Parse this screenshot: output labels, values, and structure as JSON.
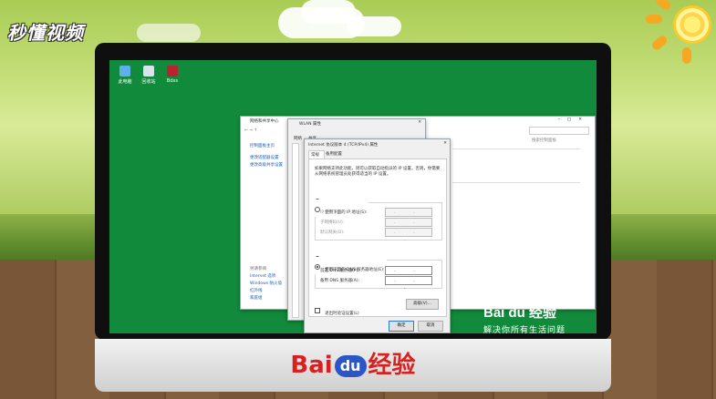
{
  "brand": {
    "name": "秒懂视频"
  },
  "desktop": {
    "icons": [
      {
        "label": "此电脑"
      },
      {
        "label": "回收站"
      },
      {
        "label": "Bdxs"
      }
    ]
  },
  "network_center": {
    "title": "网络和共享中心",
    "sidebar": [
      "控制面板主页",
      "更改适配器设置",
      "更改高级共享设置"
    ],
    "see_also": "另请参阅",
    "see_also_links": [
      "Internet 选项",
      "Windows 防火墙",
      "红外线",
      "家庭组"
    ],
    "search_placeholder": "搜索控制面板"
  },
  "wlan_props": {
    "title": "WLAN 属性",
    "tabs": [
      "网络",
      "共享"
    ]
  },
  "ipv4": {
    "title": "Internet 协议版本 4 (TCP/IPv4) 属性",
    "tabs": [
      "常规",
      "备用配置"
    ],
    "description": "如果网络支持此功能，则可以获取自动指派的 IP 设置。否则，你需要从网络系统管理员处获得适当的 IP 设置。",
    "auto_ip_label": "自动获得 IP 地址(O)",
    "manual_ip_label": "使用下面的 IP 地址(S):",
    "ip_field_label": "IP 地址(I):",
    "subnet_label": "子网掩码(U):",
    "gateway_label": "默认网关(D):",
    "auto_dns_label": "自动获得 DNS 服务器地址(B)",
    "manual_dns_label": "使用下面的 DNS 服务器地址(E):",
    "preferred_dns_label": "首选 DNS 服务器(P):",
    "alternate_dns_label": "备用 DNS 服务器(A):",
    "ip_placeholder": ". . .",
    "validate_label": "退出时验证设置(L)",
    "advanced_button": "高级(V)...",
    "ok_button": "确定",
    "cancel_button": "取消",
    "selected_ip_mode": "auto",
    "selected_dns_mode": "manual"
  },
  "watermark": {
    "logo": "Bai du 经验",
    "subtitle": "解决你所有生活问题"
  },
  "chin_logo": {
    "left": "Bai",
    "du": "du",
    "right": "经验"
  },
  "colors": {
    "desktop_green": "#128a3c",
    "baidu_red": "#d9201f",
    "baidu_blue": "#2a56c6"
  }
}
